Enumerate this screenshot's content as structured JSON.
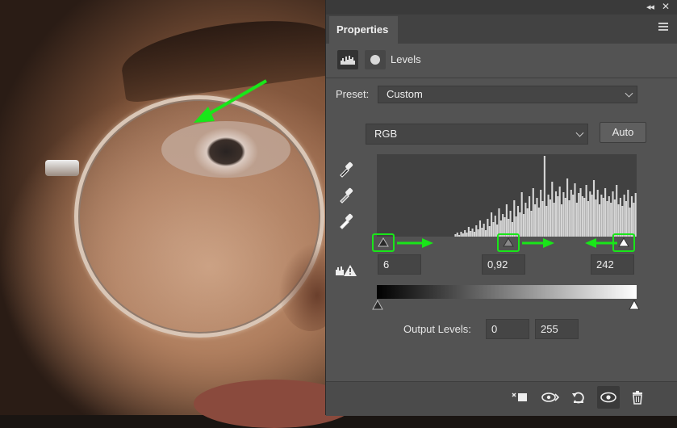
{
  "panel": {
    "tab_label": "Properties",
    "adjustment_name": "Levels",
    "preset": {
      "label": "Preset:",
      "value": "Custom"
    },
    "channel": {
      "value": "RGB"
    },
    "auto_label": "Auto",
    "input_levels": {
      "black": "6",
      "gamma": "0,92",
      "white": "242"
    },
    "output_levels": {
      "label": "Output Levels:",
      "black": "0",
      "white": "255"
    }
  },
  "colors": {
    "annotation": "#19e619",
    "panel_bg": "#535353"
  },
  "chart_data": {
    "type": "bar",
    "description_values": [
      0,
      0,
      0,
      0,
      0,
      0,
      0,
      0,
      0,
      0,
      0,
      0,
      0,
      0,
      0,
      0,
      0,
      0,
      0,
      0,
      0,
      0,
      0,
      0,
      0,
      0,
      0,
      0,
      0,
      0,
      0,
      0,
      0,
      0,
      0,
      0,
      0,
      0,
      0,
      0,
      0,
      3,
      5,
      2,
      6,
      4,
      8,
      5,
      12,
      7,
      10,
      6,
      14,
      9,
      20,
      11,
      16,
      8,
      22,
      13,
      30,
      18,
      26,
      15,
      35,
      20,
      28,
      24,
      40,
      22,
      32,
      18,
      45,
      25,
      38,
      30,
      55,
      28,
      42,
      35,
      50,
      32,
      60,
      40,
      48,
      36,
      58,
      44,
      100,
      38,
      52,
      46,
      68,
      42,
      56,
      50,
      62,
      40,
      55,
      48,
      72,
      45,
      58,
      52,
      66,
      42,
      54,
      60,
      50,
      48,
      64,
      44,
      56,
      52,
      70,
      46,
      58,
      40,
      52,
      48,
      60,
      44,
      50,
      42,
      56,
      46,
      64,
      40,
      48,
      38,
      52,
      44,
      58,
      36,
      50,
      42,
      54
    ],
    "xlim": [
      0,
      255
    ],
    "ylim": [
      0,
      100
    ],
    "sliders": {
      "black": 6,
      "gamma": 0.92,
      "white": 242
    }
  }
}
